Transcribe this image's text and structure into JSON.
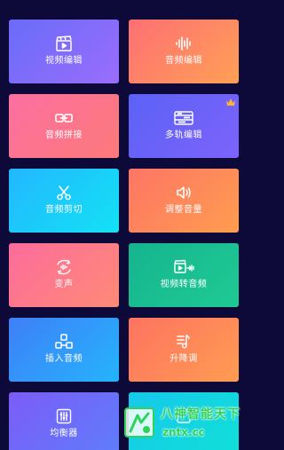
{
  "colors": {
    "background": "#0d0a3a",
    "crown": "#ffb238",
    "watermark": "#2ed35a"
  },
  "tools": [
    {
      "label": "视频编辑",
      "icon": "video-clapper-icon"
    },
    {
      "label": "音频编辑",
      "icon": "audio-waveform-icon"
    },
    {
      "label": "音频拼接",
      "icon": "audio-link-icon"
    },
    {
      "label": "多轨编辑",
      "icon": "multitrack-icon",
      "badge": "crown-icon"
    },
    {
      "label": "音频剪切",
      "icon": "scissors-icon"
    },
    {
      "label": "调整音量",
      "icon": "speaker-volume-icon"
    },
    {
      "label": "变声",
      "icon": "voice-change-icon"
    },
    {
      "label": "视频转音频",
      "icon": "video-to-audio-icon"
    },
    {
      "label": "插入音频",
      "icon": "insert-audio-icon"
    },
    {
      "label": "升降调",
      "icon": "pitch-shift-icon"
    },
    {
      "label": "均衡器",
      "icon": "equalizer-icon"
    },
    {
      "label": "",
      "icon": "unknown-icon"
    }
  ],
  "watermark": {
    "title": "八神智能天下",
    "url": "zntx.cc"
  }
}
